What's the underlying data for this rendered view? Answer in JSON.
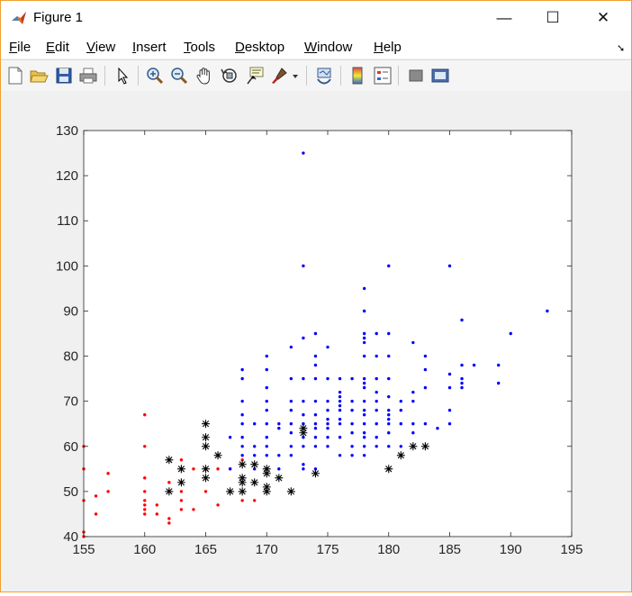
{
  "window": {
    "title": "Figure 1",
    "minimize": "—",
    "maximize": "☐",
    "close": "✕"
  },
  "menu": {
    "items": [
      {
        "key": "F",
        "rest": "ile"
      },
      {
        "key": "E",
        "rest": "dit"
      },
      {
        "key": "V",
        "rest": "iew"
      },
      {
        "key": "I",
        "rest": "nsert"
      },
      {
        "key": "T",
        "rest": "ools"
      },
      {
        "key": "D",
        "rest": "esktop"
      },
      {
        "key": "W",
        "rest": "indow"
      },
      {
        "key": "H",
        "rest": "elp"
      }
    ]
  },
  "toolbar": {
    "icons": [
      "new-figure-icon",
      "open-file-icon",
      "save-icon",
      "print-icon",
      "select-pointer-icon",
      "zoom-in-icon",
      "zoom-out-icon",
      "pan-hand-icon",
      "rotate-3d-icon",
      "data-cursor-icon",
      "brush-icon",
      "brush-dropdown-icon",
      "link-plot-icon",
      "insert-colorbar-icon",
      "insert-legend-icon",
      "hide-plot-tools-icon",
      "show-plot-tools-icon"
    ]
  },
  "colors": {
    "series_red": "#ff0000",
    "series_blue": "#0000ff",
    "series_black": "#000000",
    "axes_text": "#262626",
    "axes_box": "#262626"
  },
  "chart_data": {
    "type": "scatter",
    "title": "",
    "xlabel": "",
    "ylabel": "",
    "xlim": [
      155,
      195
    ],
    "ylim": [
      40,
      130
    ],
    "xticks": [
      155,
      160,
      165,
      170,
      175,
      180,
      185,
      190,
      195
    ],
    "yticks": [
      40,
      50,
      60,
      70,
      80,
      90,
      100,
      110,
      120,
      130
    ],
    "grid": false,
    "series": [
      {
        "marker": "dot",
        "color": "#ff0000",
        "points": [
          [
            155,
            60
          ],
          [
            155,
            55
          ],
          [
            155,
            48
          ],
          [
            155,
            41
          ],
          [
            155,
            40
          ],
          [
            156,
            49
          ],
          [
            156,
            45
          ],
          [
            157,
            54
          ],
          [
            157,
            50
          ],
          [
            160,
            67
          ],
          [
            160,
            60
          ],
          [
            160,
            53
          ],
          [
            160,
            50
          ],
          [
            160,
            48
          ],
          [
            160,
            47
          ],
          [
            160,
            46
          ],
          [
            160,
            45
          ],
          [
            161,
            47
          ],
          [
            161,
            45
          ],
          [
            162,
            44
          ],
          [
            162,
            43
          ],
          [
            162,
            52
          ],
          [
            163,
            57
          ],
          [
            163,
            52
          ],
          [
            163,
            50
          ],
          [
            163,
            48
          ],
          [
            163,
            46
          ],
          [
            164,
            55
          ],
          [
            164,
            46
          ],
          [
            165,
            55
          ],
          [
            165,
            50
          ],
          [
            166,
            55
          ],
          [
            166,
            47
          ],
          [
            167,
            55
          ],
          [
            168,
            57
          ],
          [
            168,
            48
          ],
          [
            169,
            48
          ],
          [
            169,
            52
          ]
        ]
      },
      {
        "marker": "dot",
        "color": "#0000ff",
        "points": [
          [
            167,
            62
          ],
          [
            167,
            55
          ],
          [
            168,
            77
          ],
          [
            168,
            75
          ],
          [
            168,
            70
          ],
          [
            168,
            67
          ],
          [
            168,
            65
          ],
          [
            168,
            62
          ],
          [
            168,
            60
          ],
          [
            168,
            58
          ],
          [
            169,
            65
          ],
          [
            169,
            60
          ],
          [
            169,
            58
          ],
          [
            169,
            55
          ],
          [
            170,
            80
          ],
          [
            170,
            77
          ],
          [
            170,
            73
          ],
          [
            170,
            70
          ],
          [
            170,
            68
          ],
          [
            170,
            65
          ],
          [
            170,
            62
          ],
          [
            170,
            60
          ],
          [
            170,
            58
          ],
          [
            170,
            55
          ],
          [
            171,
            65
          ],
          [
            171,
            64
          ],
          [
            171,
            58
          ],
          [
            171,
            55
          ],
          [
            172,
            82
          ],
          [
            172,
            75
          ],
          [
            172,
            70
          ],
          [
            172,
            68
          ],
          [
            172,
            65
          ],
          [
            172,
            63
          ],
          [
            172,
            60
          ],
          [
            172,
            58
          ],
          [
            173,
            125
          ],
          [
            173,
            100
          ],
          [
            173,
            84
          ],
          [
            173,
            75
          ],
          [
            173,
            70
          ],
          [
            173,
            67
          ],
          [
            173,
            65
          ],
          [
            173,
            62
          ],
          [
            173,
            60
          ],
          [
            173,
            56
          ],
          [
            173,
            55
          ],
          [
            174,
            85
          ],
          [
            174,
            80
          ],
          [
            174,
            78
          ],
          [
            174,
            75
          ],
          [
            174,
            70
          ],
          [
            174,
            67
          ],
          [
            174,
            65
          ],
          [
            174,
            64
          ],
          [
            174,
            62
          ],
          [
            174,
            60
          ],
          [
            174,
            55
          ],
          [
            175,
            82
          ],
          [
            175,
            75
          ],
          [
            175,
            70
          ],
          [
            175,
            68
          ],
          [
            175,
            66
          ],
          [
            175,
            65
          ],
          [
            175,
            64
          ],
          [
            175,
            62
          ],
          [
            175,
            60
          ],
          [
            176,
            75
          ],
          [
            176,
            72
          ],
          [
            176,
            71
          ],
          [
            176,
            70
          ],
          [
            176,
            69
          ],
          [
            176,
            68
          ],
          [
            176,
            66
          ],
          [
            176,
            65
          ],
          [
            176,
            62
          ],
          [
            176,
            58
          ],
          [
            177,
            75
          ],
          [
            177,
            70
          ],
          [
            177,
            68
          ],
          [
            177,
            65
          ],
          [
            177,
            63
          ],
          [
            177,
            60
          ],
          [
            177,
            58
          ],
          [
            178,
            95
          ],
          [
            178,
            90
          ],
          [
            178,
            85
          ],
          [
            178,
            84
          ],
          [
            178,
            83
          ],
          [
            178,
            80
          ],
          [
            178,
            75
          ],
          [
            178,
            74
          ],
          [
            178,
            73
          ],
          [
            178,
            70
          ],
          [
            178,
            68
          ],
          [
            178,
            67
          ],
          [
            178,
            65
          ],
          [
            178,
            63
          ],
          [
            178,
            62
          ],
          [
            178,
            60
          ],
          [
            178,
            58
          ],
          [
            179,
            85
          ],
          [
            179,
            80
          ],
          [
            179,
            75
          ],
          [
            179,
            72
          ],
          [
            179,
            70
          ],
          [
            179,
            68
          ],
          [
            179,
            65
          ],
          [
            179,
            62
          ],
          [
            179,
            60
          ],
          [
            180,
            100
          ],
          [
            180,
            85
          ],
          [
            180,
            80
          ],
          [
            180,
            75
          ],
          [
            180,
            71
          ],
          [
            180,
            68
          ],
          [
            180,
            67
          ],
          [
            180,
            66
          ],
          [
            180,
            65
          ],
          [
            180,
            63
          ],
          [
            180,
            60
          ],
          [
            181,
            70
          ],
          [
            181,
            68
          ],
          [
            181,
            65
          ],
          [
            181,
            60
          ],
          [
            182,
            83
          ],
          [
            182,
            72
          ],
          [
            182,
            70
          ],
          [
            182,
            65
          ],
          [
            182,
            63
          ],
          [
            182,
            60
          ],
          [
            183,
            80
          ],
          [
            183,
            77
          ],
          [
            183,
            73
          ],
          [
            183,
            65
          ],
          [
            184,
            64
          ],
          [
            185,
            100
          ],
          [
            185,
            76
          ],
          [
            185,
            73
          ],
          [
            185,
            68
          ],
          [
            185,
            65
          ],
          [
            186,
            88
          ],
          [
            186,
            78
          ],
          [
            186,
            75
          ],
          [
            186,
            74
          ],
          [
            186,
            73
          ],
          [
            187,
            78
          ],
          [
            189,
            78
          ],
          [
            189,
            74
          ],
          [
            190,
            85
          ],
          [
            193,
            90
          ]
        ]
      },
      {
        "marker": "asterisk",
        "color": "#000000",
        "points": [
          [
            162,
            57
          ],
          [
            162,
            50
          ],
          [
            163,
            55
          ],
          [
            163,
            52
          ],
          [
            165,
            65
          ],
          [
            165,
            62
          ],
          [
            165,
            60
          ],
          [
            165,
            55
          ],
          [
            165,
            53
          ],
          [
            166,
            58
          ],
          [
            167,
            50
          ],
          [
            168,
            56
          ],
          [
            168,
            53
          ],
          [
            168,
            52
          ],
          [
            168,
            50
          ],
          [
            169,
            56
          ],
          [
            169,
            52
          ],
          [
            170,
            55
          ],
          [
            170,
            54
          ],
          [
            170,
            51
          ],
          [
            170,
            50
          ],
          [
            171,
            53
          ],
          [
            172,
            50
          ],
          [
            173,
            64
          ],
          [
            173,
            63
          ],
          [
            174,
            54
          ],
          [
            180,
            55
          ],
          [
            181,
            58
          ],
          [
            182,
            60
          ],
          [
            183,
            60
          ]
        ]
      }
    ]
  }
}
